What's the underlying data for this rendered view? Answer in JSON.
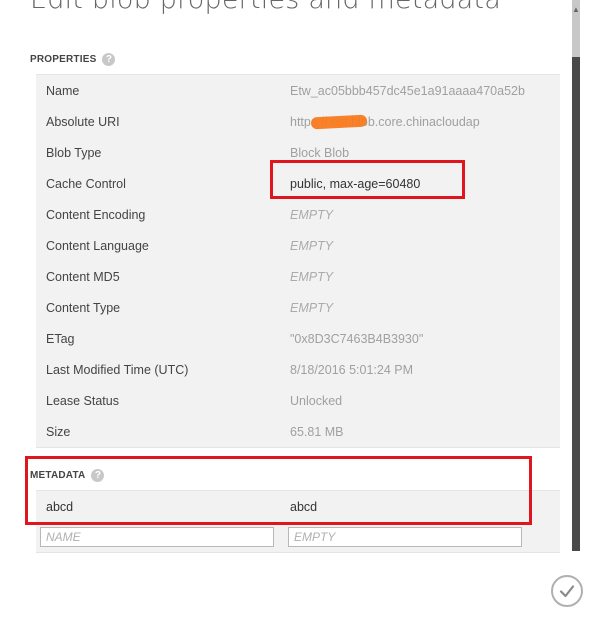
{
  "dialog": {
    "title": "Edit blob properties and metadata"
  },
  "properties": {
    "heading": "PROPERTIES",
    "rows": [
      {
        "name": "Name",
        "value": "Etw_ac05bbb457dc45e1a91aaaa470a52b",
        "kind": "readonly"
      },
      {
        "name": "Absolute URI",
        "value": "https://          est.blob.core.chinacloudap",
        "kind": "readonly"
      },
      {
        "name": "Blob Type",
        "value": "Block Blob",
        "kind": "readonly"
      },
      {
        "name": "Cache Control",
        "value": "public, max-age=60480",
        "kind": "editable"
      },
      {
        "name": "Content Encoding",
        "value": "EMPTY",
        "kind": "empty"
      },
      {
        "name": "Content Language",
        "value": "EMPTY",
        "kind": "empty"
      },
      {
        "name": "Content MD5",
        "value": "EMPTY",
        "kind": "empty"
      },
      {
        "name": "Content Type",
        "value": "EMPTY",
        "kind": "empty"
      },
      {
        "name": "ETag",
        "value": "\"0x8D3C7463B4B3930\"",
        "kind": "readonly"
      },
      {
        "name": "Last Modified Time (UTC)",
        "value": "8/18/2016 5:01:24 PM",
        "kind": "readonly"
      },
      {
        "name": "Lease Status",
        "value": "Unlocked",
        "kind": "readonly"
      },
      {
        "name": "Size",
        "value": "65.81 MB",
        "kind": "readonly"
      }
    ]
  },
  "metadata": {
    "heading": "METADATA",
    "entries": [
      {
        "name": "abcd",
        "value": "abcd"
      }
    ],
    "new_name_placeholder": "NAME",
    "new_value_placeholder": "EMPTY"
  },
  "icons": {
    "help": "question-circle-icon",
    "confirm": "checkmark-icon"
  },
  "colors": {
    "highlight": "#e0151d",
    "redaction": "#f97a1f",
    "row_background": "#f2f2f2"
  }
}
